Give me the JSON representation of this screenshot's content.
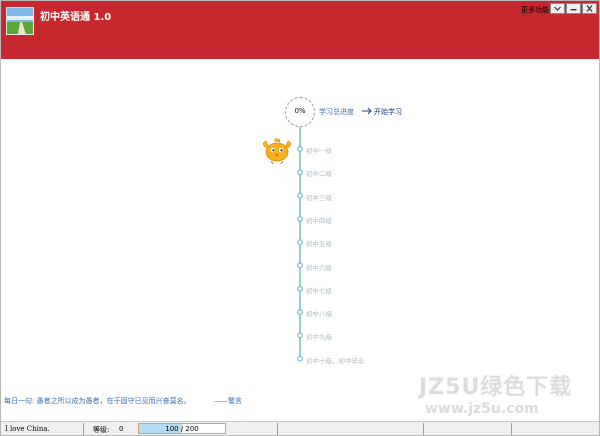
{
  "window": {
    "title": "初中英语通 1.0",
    "more_menu": "更多功能",
    "brand_color": "#c7272e"
  },
  "icons": {
    "logo": "landscape-logo-icon",
    "dropdown": "chevron-down-icon",
    "minimize": "minimize-icon",
    "close": "close-icon",
    "arrow": "arrow-right-icon",
    "mascot": "chick-mascot-icon"
  },
  "progress": {
    "percent_text": "0%",
    "label": "学习总进度",
    "start_label": "开始学习"
  },
  "levels": [
    {
      "label": "初中一级"
    },
    {
      "label": "初中二级"
    },
    {
      "label": "初中三级"
    },
    {
      "label": "初中四级"
    },
    {
      "label": "初中五级"
    },
    {
      "label": "初中六级"
    },
    {
      "label": "初中七级"
    },
    {
      "label": "初中八级"
    },
    {
      "label": "初中九级"
    },
    {
      "label": "初中十级，初中毕业"
    }
  ],
  "quote": {
    "prefix": "每日一句:",
    "text": "愚者之所以成为愚者，在于固守已见而兴奋莫名。",
    "author": "——警言"
  },
  "watermark": {
    "top": "JZ5U绿色下载",
    "bottom": "www.jz5u.com"
  },
  "status": {
    "text": "I love China.",
    "level_label": "等级:",
    "level_value": "0",
    "xp_text": "100 / 200",
    "xp_current": 100,
    "xp_max": 200
  }
}
